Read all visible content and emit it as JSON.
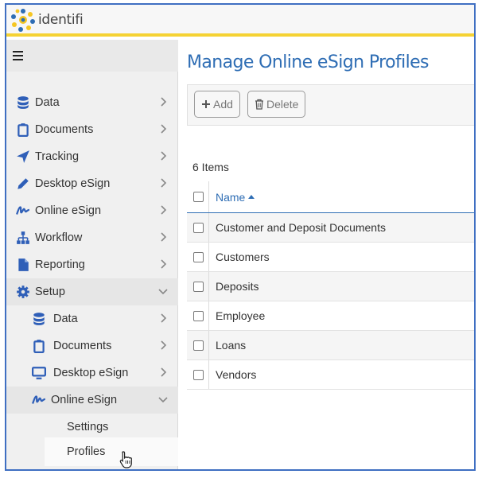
{
  "app": {
    "logo_text": "identifi"
  },
  "sidebar": {
    "menu_icon": "hamburger-icon",
    "items": [
      {
        "label": "Data",
        "icon": "database-icon"
      },
      {
        "label": "Documents",
        "icon": "clipboard-icon"
      },
      {
        "label": "Tracking",
        "icon": "location-arrow-icon"
      },
      {
        "label": "Desktop eSign",
        "icon": "pencil-icon"
      },
      {
        "label": "Online eSign",
        "icon": "signature-icon"
      },
      {
        "label": "Workflow",
        "icon": "sitemap-icon"
      },
      {
        "label": "Reporting",
        "icon": "file-icon"
      },
      {
        "label": "Setup",
        "icon": "gear-icon",
        "expanded": true
      }
    ],
    "setup_children": [
      {
        "label": "Data",
        "icon": "database-icon"
      },
      {
        "label": "Documents",
        "icon": "clipboard-icon"
      },
      {
        "label": "Desktop eSign",
        "icon": "monitor-icon"
      },
      {
        "label": "Online eSign",
        "icon": "signature-icon",
        "expanded": true
      }
    ],
    "online_esign_children": [
      {
        "label": "Settings"
      },
      {
        "label": "Profiles",
        "selected": true
      }
    ]
  },
  "main": {
    "title": "Manage Online eSign Profiles",
    "toolbar": {
      "add_label": "Add",
      "delete_label": "Delete"
    },
    "items_count": "6 Items",
    "table": {
      "column_name": "Name",
      "sort": "ascending",
      "rows": [
        "Customer and Deposit Documents",
        "Customers",
        "Deposits",
        "Employee",
        "Loans",
        "Vendors"
      ]
    }
  },
  "colors": {
    "accent": "#2e6db4",
    "header_stripe": "#f5d233",
    "frame_border": "#3f6fc2"
  }
}
